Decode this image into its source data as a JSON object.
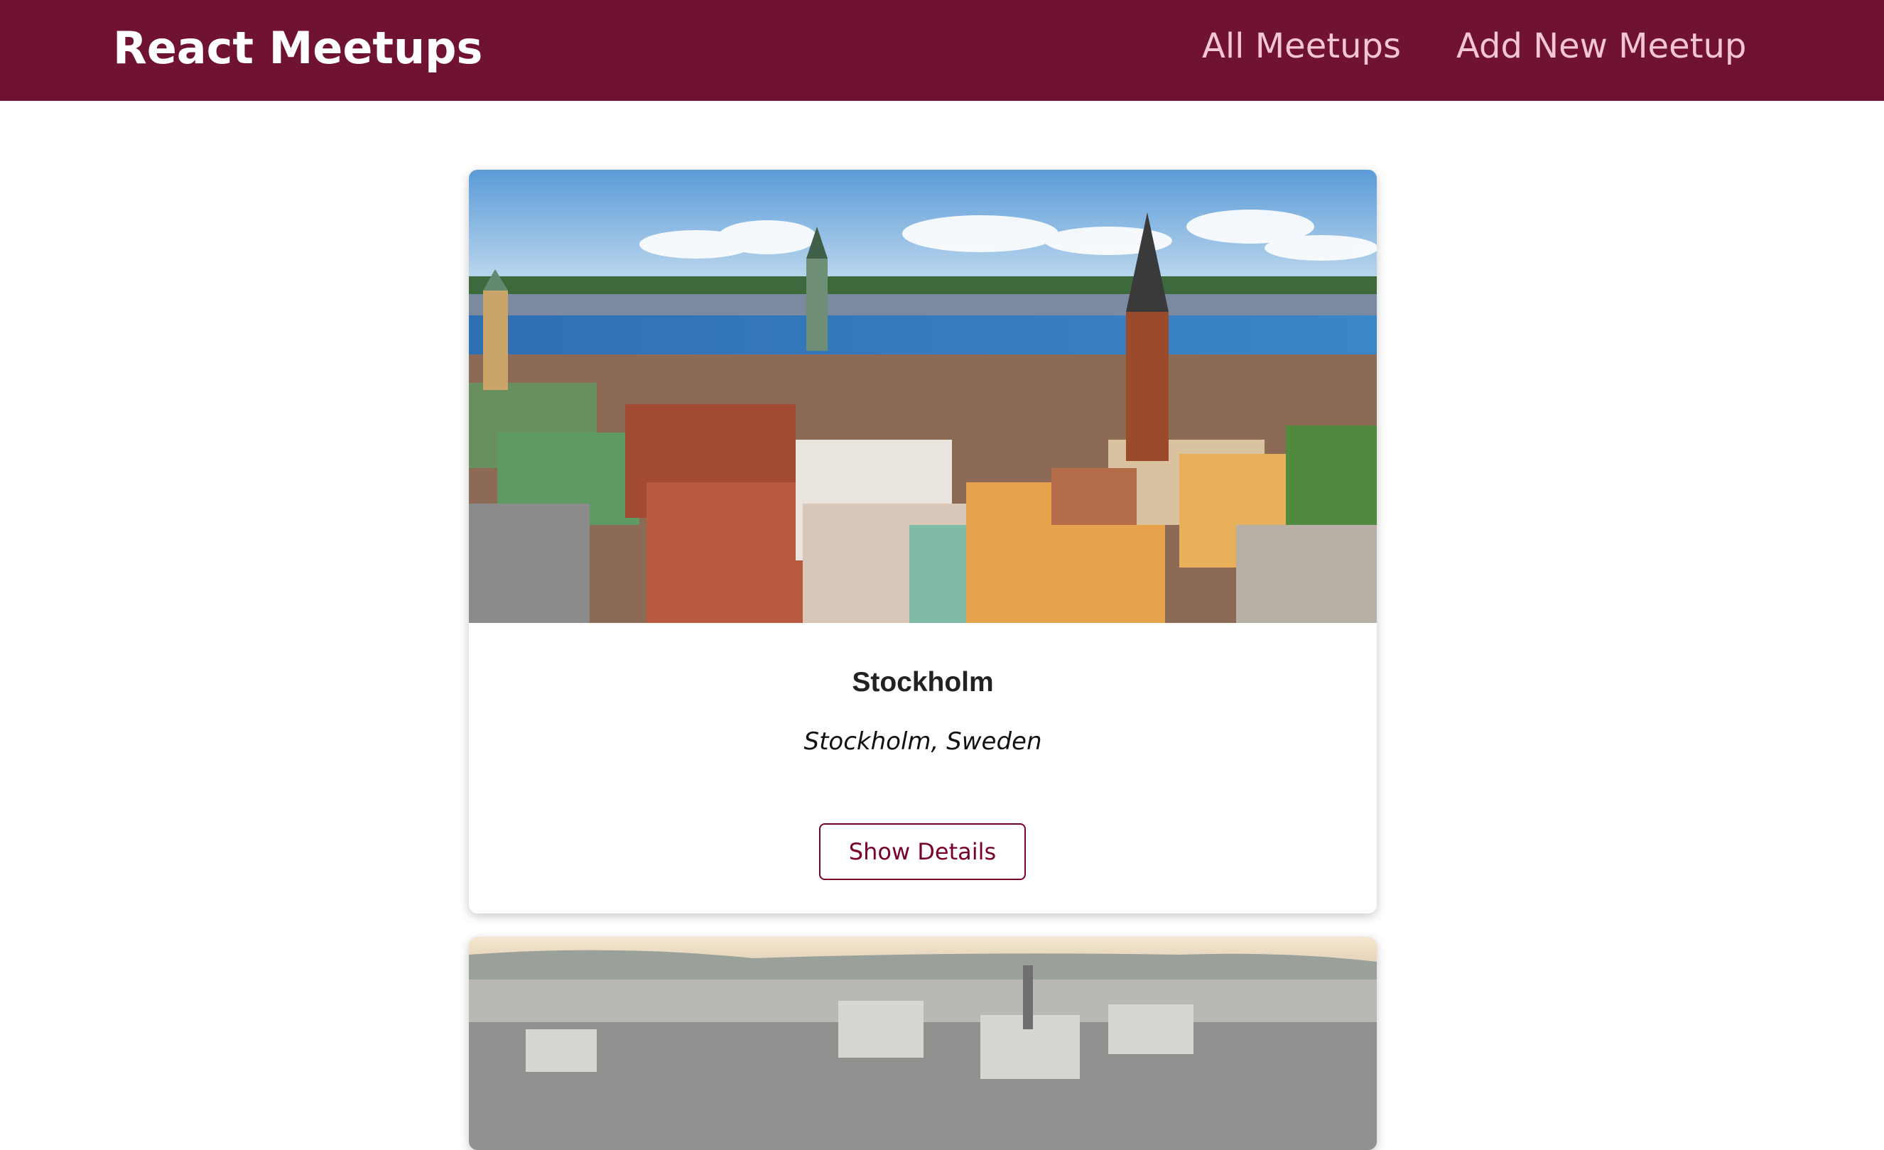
{
  "header": {
    "logo": "React Meetups",
    "nav": {
      "all_meetups": "All Meetups",
      "add_new_meetup": "Add New Meetup"
    }
  },
  "meetups": [
    {
      "title": "Stockholm",
      "address": "Stockholm, Sweden",
      "button_label": "Show Details",
      "image": "stockholm-cityscape-photo"
    },
    {
      "image": "city-skyline-photo"
    }
  ],
  "colors": {
    "header_bg": "#6f1330",
    "nav_text": "#f4c5d6",
    "accent": "#77002e"
  }
}
